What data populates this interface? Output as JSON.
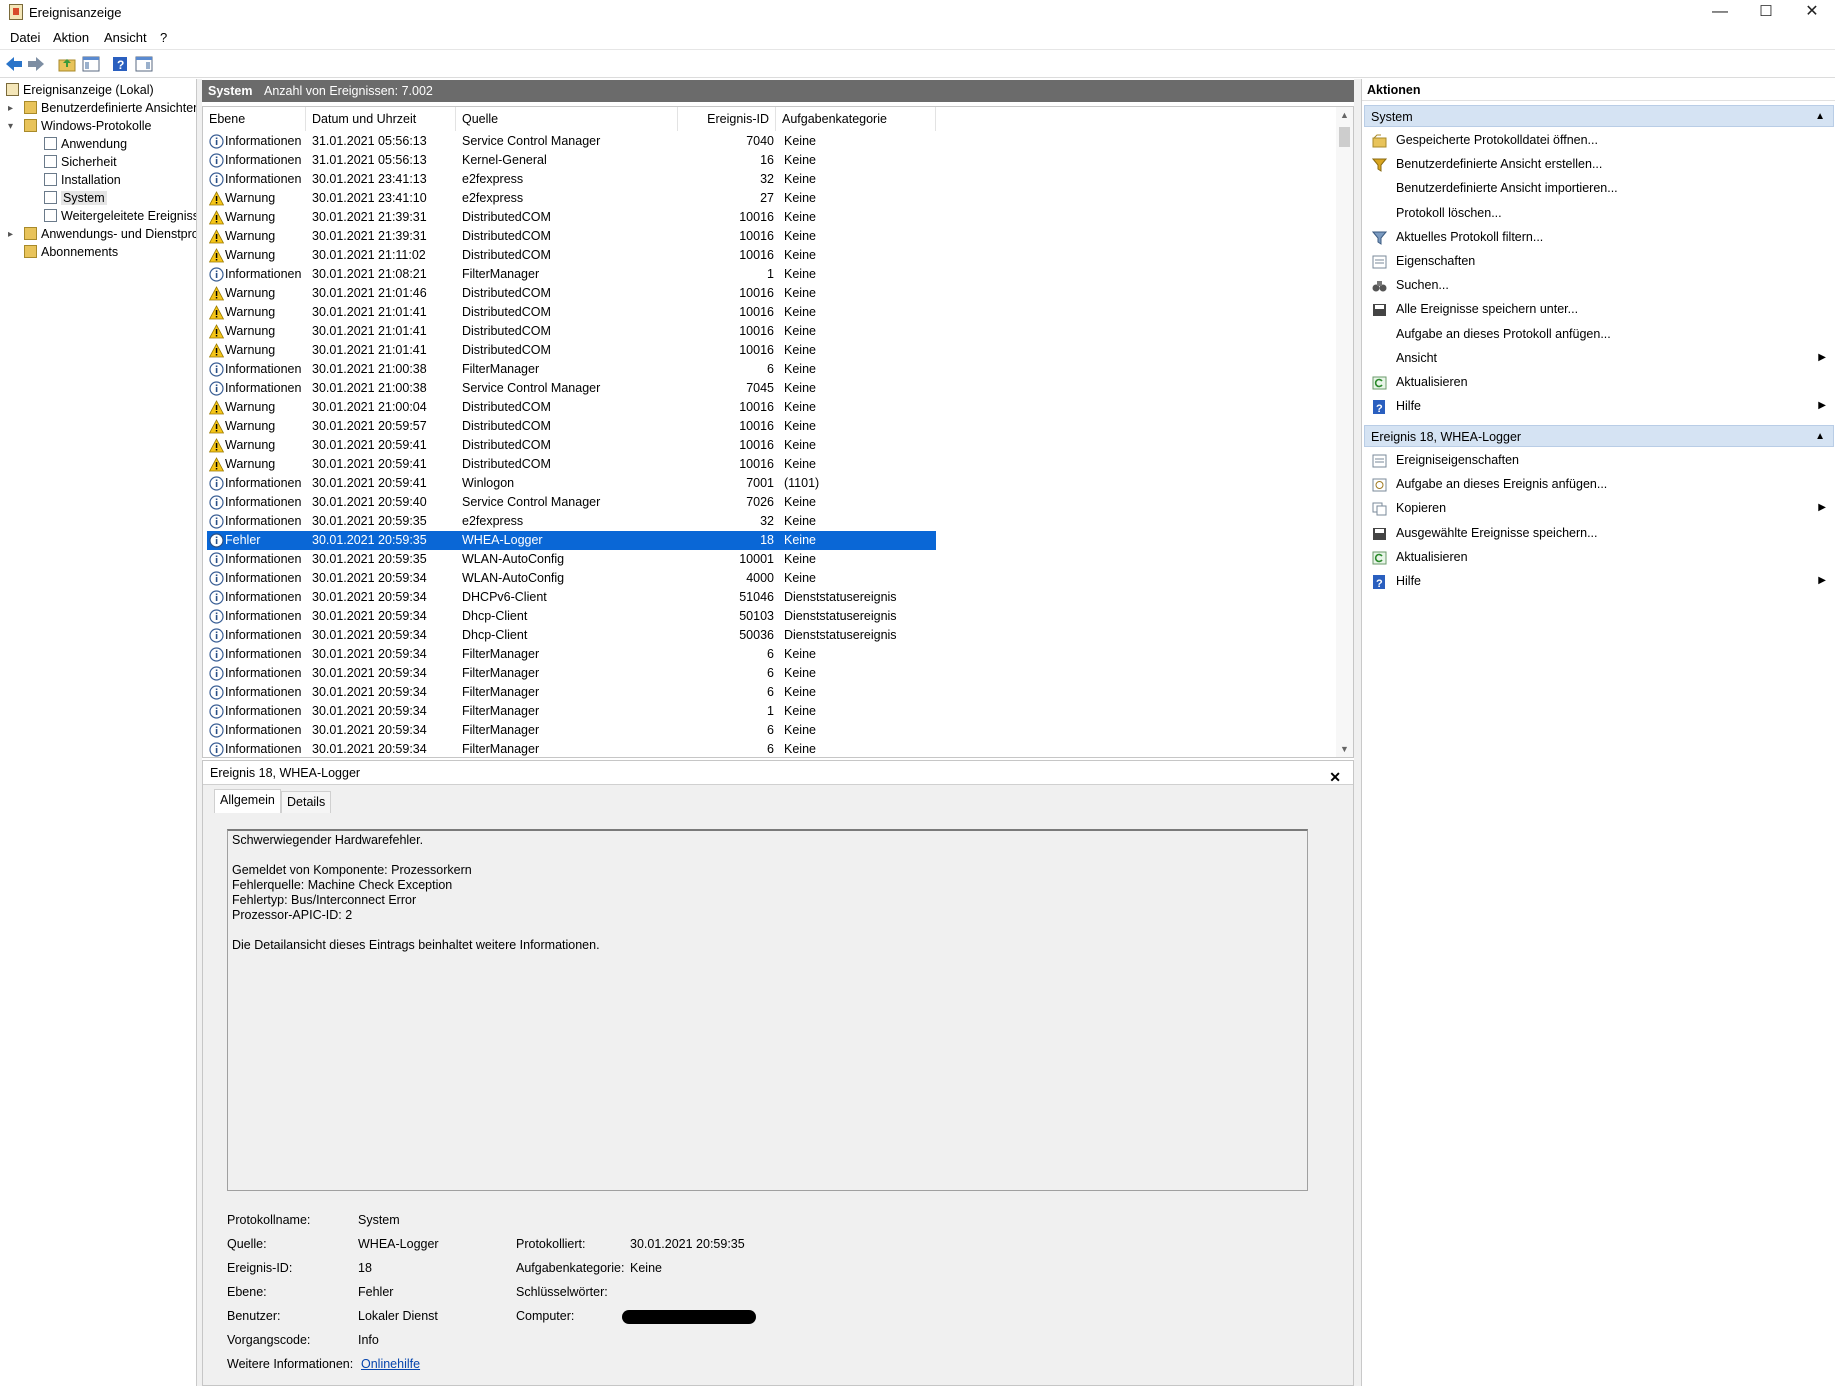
{
  "window": {
    "title": "Ereignisanzeige",
    "minimize": "—",
    "maximize": "☐",
    "close": "✕"
  },
  "menu": [
    "Datei",
    "Aktion",
    "Ansicht",
    "?"
  ],
  "tree": {
    "root": "Ereignisanzeige (Lokal)",
    "custom_views": "Benutzerdefinierte Ansichten",
    "windows_logs": "Windows-Protokolle",
    "logs": [
      "Anwendung",
      "Sicherheit",
      "Installation",
      "System",
      "Weitergeleitete Ereignisse"
    ],
    "app_logs": "Anwendungs- und Dienstprotokolle",
    "subscriptions": "Abonnements"
  },
  "center": {
    "title": "System",
    "count_label": "Anzahl von Ereignissen: 7.002"
  },
  "columns": [
    "Ebene",
    "Datum und Uhrzeit",
    "Quelle",
    "Ereignis-ID",
    "Aufgabenkategorie"
  ],
  "events": [
    {
      "level": "Informationen",
      "kind": "info",
      "date": "31.01.2021 05:56:13",
      "source": "Service Control Manager",
      "id": "7040",
      "category": "Keine"
    },
    {
      "level": "Informationen",
      "kind": "info",
      "date": "31.01.2021 05:56:13",
      "source": "Kernel-General",
      "id": "16",
      "category": "Keine"
    },
    {
      "level": "Informationen",
      "kind": "info",
      "date": "30.01.2021 23:41:13",
      "source": "e2fexpress",
      "id": "32",
      "category": "Keine"
    },
    {
      "level": "Warnung",
      "kind": "warn",
      "date": "30.01.2021 23:41:10",
      "source": "e2fexpress",
      "id": "27",
      "category": "Keine"
    },
    {
      "level": "Warnung",
      "kind": "warn",
      "date": "30.01.2021 21:39:31",
      "source": "DistributedCOM",
      "id": "10016",
      "category": "Keine"
    },
    {
      "level": "Warnung",
      "kind": "warn",
      "date": "30.01.2021 21:39:31",
      "source": "DistributedCOM",
      "id": "10016",
      "category": "Keine"
    },
    {
      "level": "Warnung",
      "kind": "warn",
      "date": "30.01.2021 21:11:02",
      "source": "DistributedCOM",
      "id": "10016",
      "category": "Keine"
    },
    {
      "level": "Informationen",
      "kind": "info",
      "date": "30.01.2021 21:08:21",
      "source": "FilterManager",
      "id": "1",
      "category": "Keine"
    },
    {
      "level": "Warnung",
      "kind": "warn",
      "date": "30.01.2021 21:01:46",
      "source": "DistributedCOM",
      "id": "10016",
      "category": "Keine"
    },
    {
      "level": "Warnung",
      "kind": "warn",
      "date": "30.01.2021 21:01:41",
      "source": "DistributedCOM",
      "id": "10016",
      "category": "Keine"
    },
    {
      "level": "Warnung",
      "kind": "warn",
      "date": "30.01.2021 21:01:41",
      "source": "DistributedCOM",
      "id": "10016",
      "category": "Keine"
    },
    {
      "level": "Warnung",
      "kind": "warn",
      "date": "30.01.2021 21:01:41",
      "source": "DistributedCOM",
      "id": "10016",
      "category": "Keine"
    },
    {
      "level": "Informationen",
      "kind": "info",
      "date": "30.01.2021 21:00:38",
      "source": "FilterManager",
      "id": "6",
      "category": "Keine"
    },
    {
      "level": "Informationen",
      "kind": "info",
      "date": "30.01.2021 21:00:38",
      "source": "Service Control Manager",
      "id": "7045",
      "category": "Keine"
    },
    {
      "level": "Warnung",
      "kind": "warn",
      "date": "30.01.2021 21:00:04",
      "source": "DistributedCOM",
      "id": "10016",
      "category": "Keine"
    },
    {
      "level": "Warnung",
      "kind": "warn",
      "date": "30.01.2021 20:59:57",
      "source": "DistributedCOM",
      "id": "10016",
      "category": "Keine"
    },
    {
      "level": "Warnung",
      "kind": "warn",
      "date": "30.01.2021 20:59:41",
      "source": "DistributedCOM",
      "id": "10016",
      "category": "Keine"
    },
    {
      "level": "Warnung",
      "kind": "warn",
      "date": "30.01.2021 20:59:41",
      "source": "DistributedCOM",
      "id": "10016",
      "category": "Keine"
    },
    {
      "level": "Informationen",
      "kind": "info",
      "date": "30.01.2021 20:59:41",
      "source": "Winlogon",
      "id": "7001",
      "category": "(1101)"
    },
    {
      "level": "Informationen",
      "kind": "info",
      "date": "30.01.2021 20:59:40",
      "source": "Service Control Manager",
      "id": "7026",
      "category": "Keine"
    },
    {
      "level": "Informationen",
      "kind": "info",
      "date": "30.01.2021 20:59:35",
      "source": "e2fexpress",
      "id": "32",
      "category": "Keine"
    },
    {
      "level": "Fehler",
      "kind": "error",
      "date": "30.01.2021 20:59:35",
      "source": "WHEA-Logger",
      "id": "18",
      "category": "Keine",
      "selected": true
    },
    {
      "level": "Informationen",
      "kind": "info",
      "date": "30.01.2021 20:59:35",
      "source": "WLAN-AutoConfig",
      "id": "10001",
      "category": "Keine"
    },
    {
      "level": "Informationen",
      "kind": "info",
      "date": "30.01.2021 20:59:34",
      "source": "WLAN-AutoConfig",
      "id": "4000",
      "category": "Keine"
    },
    {
      "level": "Informationen",
      "kind": "info",
      "date": "30.01.2021 20:59:34",
      "source": "DHCPv6-Client",
      "id": "51046",
      "category": "Dienststatusereignis"
    },
    {
      "level": "Informationen",
      "kind": "info",
      "date": "30.01.2021 20:59:34",
      "source": "Dhcp-Client",
      "id": "50103",
      "category": "Dienststatusereignis"
    },
    {
      "level": "Informationen",
      "kind": "info",
      "date": "30.01.2021 20:59:34",
      "source": "Dhcp-Client",
      "id": "50036",
      "category": "Dienststatusereignis"
    },
    {
      "level": "Informationen",
      "kind": "info",
      "date": "30.01.2021 20:59:34",
      "source": "FilterManager",
      "id": "6",
      "category": "Keine"
    },
    {
      "level": "Informationen",
      "kind": "info",
      "date": "30.01.2021 20:59:34",
      "source": "FilterManager",
      "id": "6",
      "category": "Keine"
    },
    {
      "level": "Informationen",
      "kind": "info",
      "date": "30.01.2021 20:59:34",
      "source": "FilterManager",
      "id": "6",
      "category": "Keine"
    },
    {
      "level": "Informationen",
      "kind": "info",
      "date": "30.01.2021 20:59:34",
      "source": "FilterManager",
      "id": "1",
      "category": "Keine"
    },
    {
      "level": "Informationen",
      "kind": "info",
      "date": "30.01.2021 20:59:34",
      "source": "FilterManager",
      "id": "6",
      "category": "Keine"
    },
    {
      "level": "Informationen",
      "kind": "info",
      "date": "30.01.2021 20:59:34",
      "source": "FilterManager",
      "id": "6",
      "category": "Keine"
    }
  ],
  "detail": {
    "header": "Ereignis 18, WHEA-Logger",
    "tabs": [
      "Allgemein",
      "Details"
    ],
    "message": [
      "Schwerwiegender Hardwarefehler.",
      "",
      "Gemeldet von Komponente: Prozessorkern",
      "Fehlerquelle: Machine Check Exception",
      "Fehlertyp: Bus/Interconnect Error",
      "Prozessor-APIC-ID: 2",
      "",
      "Die Detailansicht dieses Eintrags beinhaltet weitere Informationen."
    ],
    "labels": {
      "logname": "Protokollname:",
      "source": "Quelle:",
      "eventid": "Ereignis-ID:",
      "level": "Ebene:",
      "user": "Benutzer:",
      "opcode": "Vorgangscode:",
      "moreinfo": "Weitere Informationen:",
      "logged": "Protokolliert:",
      "category": "Aufgabenkategorie:",
      "keywords": "Schlüsselwörter:",
      "computer": "Computer:"
    },
    "values": {
      "logname": "System",
      "source": "WHEA-Logger",
      "eventid": "18",
      "level": "Fehler",
      "user": "Lokaler Dienst",
      "opcode": "Info",
      "moreinfo": "Onlinehilfe",
      "logged": "30.01.2021 20:59:35",
      "category": "Keine",
      "keywords": ""
    }
  },
  "actions": {
    "title": "Aktionen",
    "section1": "System",
    "items1": [
      {
        "label": "Gespeicherte Protokolldatei öffnen...",
        "icon": "open-folder-icon"
      },
      {
        "label": "Benutzerdefinierte Ansicht erstellen...",
        "icon": "funnel-icon"
      },
      {
        "label": "Benutzerdefinierte Ansicht importieren...",
        "icon": ""
      },
      {
        "label": "Protokoll löschen...",
        "icon": ""
      },
      {
        "label": "Aktuelles Protokoll filtern...",
        "icon": "filter-icon"
      },
      {
        "label": "Eigenschaften",
        "icon": "properties-icon"
      },
      {
        "label": "Suchen...",
        "icon": "binoculars-icon"
      },
      {
        "label": "Alle Ereignisse speichern unter...",
        "icon": "save-icon"
      },
      {
        "label": "Aufgabe an dieses Protokoll anfügen...",
        "icon": ""
      },
      {
        "label": "Ansicht",
        "icon": "",
        "submenu": true
      },
      {
        "label": "Aktualisieren",
        "icon": "refresh-icon"
      },
      {
        "label": "Hilfe",
        "icon": "help-icon",
        "submenu": true
      }
    ],
    "section2": "Ereignis 18, WHEA-Logger",
    "items2": [
      {
        "label": "Ereigniseigenschaften",
        "icon": "properties-icon"
      },
      {
        "label": "Aufgabe an dieses Ereignis anfügen...",
        "icon": "task-icon"
      },
      {
        "label": "Kopieren",
        "icon": "copy-icon",
        "submenu": true
      },
      {
        "label": "Ausgewählte Ereignisse speichern...",
        "icon": "save-icon"
      },
      {
        "label": "Aktualisieren",
        "icon": "refresh-icon"
      },
      {
        "label": "Hilfe",
        "icon": "help-icon",
        "submenu": true
      }
    ]
  }
}
